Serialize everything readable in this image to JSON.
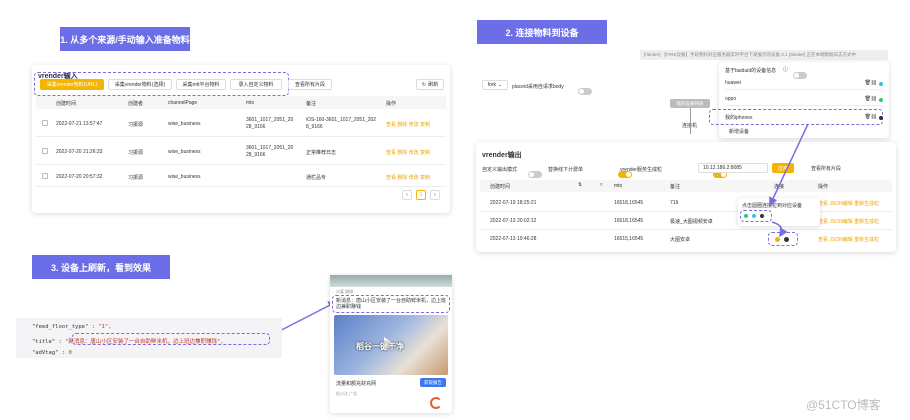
{
  "step1": {
    "banner": "1. 从多个来源/手动输入准备物料",
    "panel_title": "vrender输入",
    "tabs": [
      "采集vrender物料(URL)",
      "采集vrender物料(选择)",
      "采集mtt平台物料",
      "录入自定义物料"
    ],
    "view_all": "查看所有片段",
    "refresh": "刷新",
    "columns": [
      "创建时间",
      "创建者",
      "channelPage",
      "mts",
      "备注",
      "操作"
    ],
    "rows": [
      {
        "time": "2022-07-21 13:57:47",
        "creator": "习振源",
        "channel": "wise_business",
        "mts": "3601_1017_2051_2028_9166",
        "note": "iOS-160-3601_1017_2051_2028_9166",
        "ops": "查看 删除 修改 复制"
      },
      {
        "time": "2022-07-20 21:26:33",
        "creator": "习振源",
        "channel": "wise_business",
        "mts": "3601_1017_2051_2028_9166",
        "note": "正常推荐日志",
        "ops": "查看 删除 修改 复制"
      },
      {
        "time": "2022-07-20 20:57:32",
        "creator": "习振源",
        "channel": "wise_business",
        "mts": "",
        "note": "通栏品专",
        "ops": "查看 删除 修改 复制"
      }
    ],
    "page": "1"
  },
  "step2": {
    "banner": "2. 连接物料到设备",
    "top_bar_text": "[rlander] 【FIRE设备】手段物料对应服务器实时平台下发展示的设备 3.1 [rlander] 正在本端数据日志方式中",
    "fork_label": "fork",
    "placeid_label": "placeid采用自请求body",
    "device_list_btn": "我的设备列表",
    "connect_label": "连接机",
    "device_header": "基于baiduid的设备信息",
    "devices": [
      "huawei",
      "oppo",
      "我的iphonex"
    ],
    "add_device": "新增设备",
    "output_title": "vrender输出",
    "custom_output": "自定义输出模式",
    "replace_label": "替换线下计费单",
    "vrender_server_label": "vrender服务生成粒",
    "server_ip": "10.12.186.2:8085",
    "apply_btn": "应用",
    "view_all": "查看所有片段",
    "columns": [
      "创建时间",
      "mts",
      "备注",
      "连接",
      "操作"
    ],
    "rows": [
      {
        "time": "2022-07-19 18:25:21",
        "mts": "16518,16545",
        "note": "719",
        "ops": "查看 JSON编辑 重新生成粒"
      },
      {
        "time": "2022-07-13 20:02:12",
        "mts": "16518,16545",
        "note": "极速_大图视频安卓",
        "ops": "查看 JSON编辑 重新生成粒"
      },
      {
        "time": "2022-07-13 19:46:28",
        "mts": "16515,16545",
        "note": "大图安卓",
        "ops": "查看 JSON编辑 重新生成粒"
      }
    ],
    "tooltip": "点击圆圈连接粒到对应设备",
    "colors": {
      "green": "#39c96d",
      "orange": "#f5b400",
      "dark": "#333333",
      "cyan": "#38c2e0"
    }
  },
  "step3": {
    "banner": "3. 设备上刷新，看到效果",
    "code_lines": [
      {
        "key": "\"feed_floor_type\"",
        "sep": " : ",
        "val": "\"1\","
      },
      {
        "key": "\"title\"",
        "sep": " : ",
        "val": "\"新消息：唐山小区安装了一台自助鲜米机，边上班边兼职赚钱\","
      },
      {
        "key": "\"adVtag\"",
        "sep": " : ",
        "val": "0"
      }
    ],
    "phone_header": "沙某 刚刚",
    "phone_title": "新消息：唐山小区安装了一台自助鲜米机，边上班边兼职赚钱",
    "video_caption": "稻谷一键干净",
    "ad_text": "流量和额充财充网",
    "ad_sub": "粒小达 广告",
    "ad_btn": "获取报告"
  },
  "watermark": "@51CTO博客"
}
